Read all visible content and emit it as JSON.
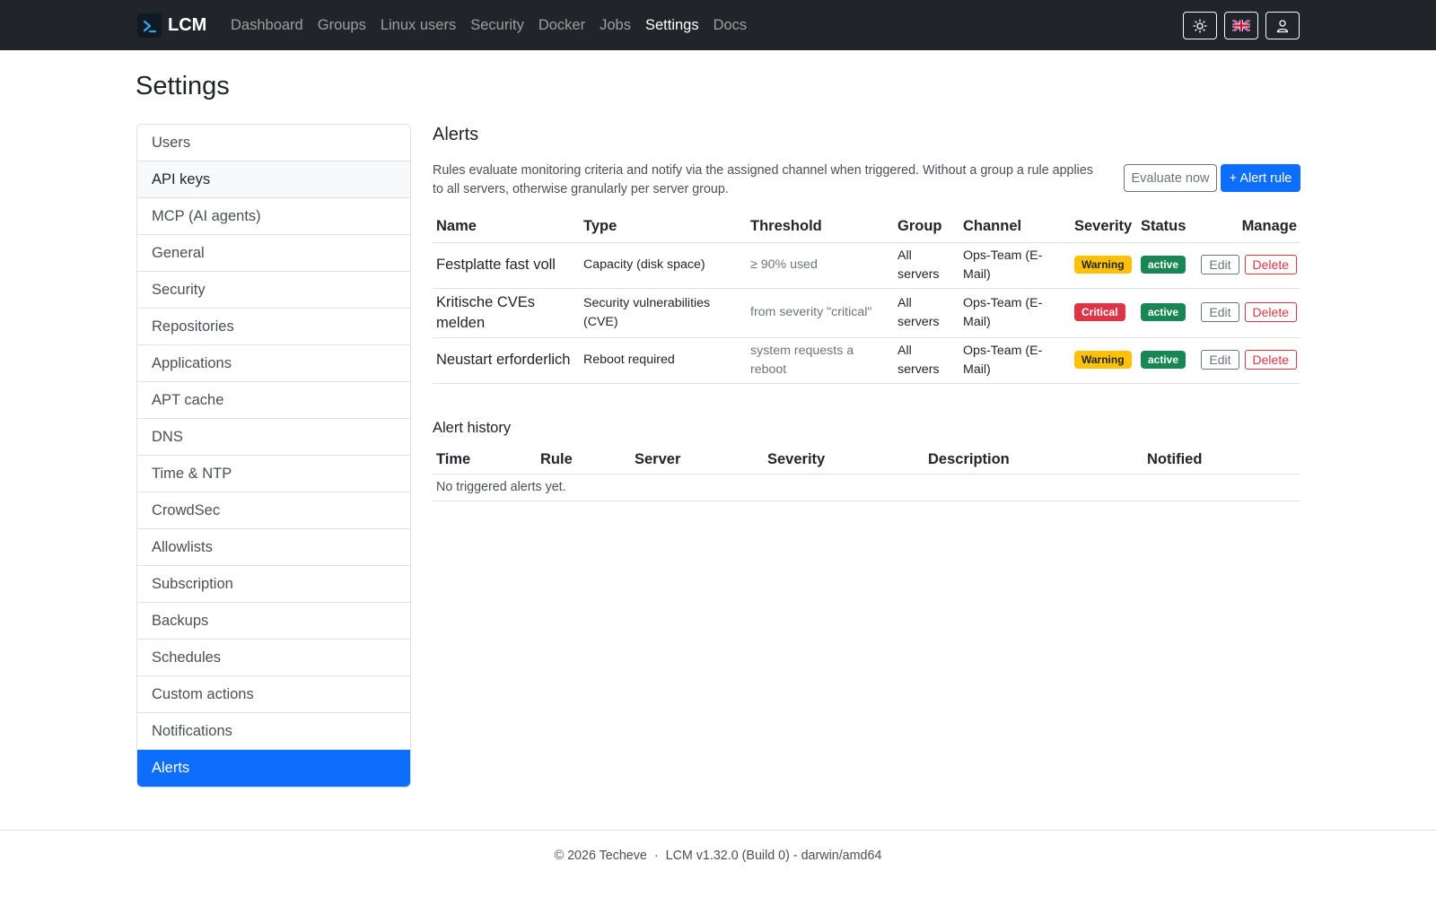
{
  "navbar": {
    "brand": "LCM",
    "links": [
      {
        "label": "Dashboard",
        "active": false
      },
      {
        "label": "Groups",
        "active": false
      },
      {
        "label": "Linux users",
        "active": false
      },
      {
        "label": "Security",
        "active": false
      },
      {
        "label": "Docker",
        "active": false
      },
      {
        "label": "Jobs",
        "active": false
      },
      {
        "label": "Settings",
        "active": true
      },
      {
        "label": "Docs",
        "active": false
      }
    ],
    "icons": [
      "sun-icon",
      "uk-flag-icon",
      "user-icon"
    ]
  },
  "page": {
    "title": "Settings"
  },
  "sidebar": {
    "items": [
      {
        "label": "Users"
      },
      {
        "label": "API keys"
      },
      {
        "label": "MCP (AI agents)"
      },
      {
        "label": "General"
      },
      {
        "label": "Security"
      },
      {
        "label": "Repositories"
      },
      {
        "label": "Applications"
      },
      {
        "label": "APT cache"
      },
      {
        "label": "DNS"
      },
      {
        "label": "Time & NTP"
      },
      {
        "label": "CrowdSec"
      },
      {
        "label": "Allowlists"
      },
      {
        "label": "Subscription"
      },
      {
        "label": "Backups"
      },
      {
        "label": "Schedules"
      },
      {
        "label": "Custom actions"
      },
      {
        "label": "Notifications"
      },
      {
        "label": "Alerts"
      }
    ],
    "active_label": "Alerts",
    "hover_label": "API keys"
  },
  "alerts": {
    "title": "Alerts",
    "description": "Rules evaluate monitoring criteria and notify via the assigned channel when triggered. Without a group a rule applies to all servers, otherwise granularly per server group.",
    "evaluate_label": "Evaluate now",
    "add_label": "+ Alert rule",
    "columns": [
      "Name",
      "Type",
      "Threshold",
      "Group",
      "Channel",
      "Severity",
      "Status",
      "Manage"
    ],
    "rules": [
      {
        "name": "Festplatte fast voll",
        "type": "Capacity (disk space)",
        "threshold": "≥ 90% used",
        "group": "All servers",
        "channel": "Ops-Team (E-Mail)",
        "severity": "Warning",
        "status": "active",
        "edit": "Edit",
        "delete": "Delete"
      },
      {
        "name": "Kritische CVEs melden",
        "type": "Security vulnerabilities (CVE)",
        "threshold": "from severity \"critical\"",
        "group": "All servers",
        "channel": "Ops-Team (E-Mail)",
        "severity": "Critical",
        "status": "active",
        "edit": "Edit",
        "delete": "Delete"
      },
      {
        "name": "Neustart erforderlich",
        "type": "Reboot required",
        "threshold": "system requests a reboot",
        "group": "All servers",
        "channel": "Ops-Team (E-Mail)",
        "severity": "Warning",
        "status": "active",
        "edit": "Edit",
        "delete": "Delete"
      }
    ]
  },
  "history": {
    "title": "Alert history",
    "columns": [
      "Time",
      "Rule",
      "Server",
      "Severity",
      "Description",
      "Notified"
    ],
    "empty": "No triggered alerts yet."
  },
  "footer": {
    "copyright": "© 2026 Techeve",
    "separator": "·",
    "version": "LCM v1.32.0 (Build 0) - darwin/amd64"
  },
  "colors": {
    "navbar": "#212529",
    "primary": "#0d6efd",
    "warning": "#ffc107",
    "danger": "#dc3545",
    "success": "#198754"
  }
}
